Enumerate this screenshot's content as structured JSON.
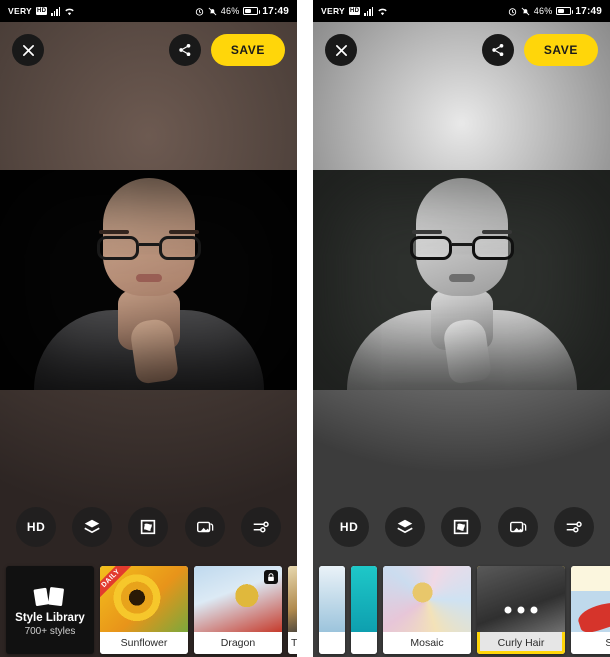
{
  "statusbar": {
    "carrier": "VERY",
    "hd_badge": "HD",
    "battery_percent": "46%",
    "time": "17:49",
    "icons": [
      "signal-bars-icon",
      "wifi-icon",
      "alarm-clock-icon",
      "bell-muted-icon",
      "battery-icon"
    ]
  },
  "topbar": {
    "close_label": "✕",
    "share_label": "share-icon",
    "save_label": "SAVE"
  },
  "tools": [
    {
      "name": "hd-button",
      "label": "HD",
      "icon": "hd-icon"
    },
    {
      "name": "layers-button",
      "label": "",
      "icon": "layers-icon"
    },
    {
      "name": "mask-button",
      "label": "",
      "icon": "mask-frame-icon"
    },
    {
      "name": "gallery-button",
      "label": "",
      "icon": "gallery-icon"
    },
    {
      "name": "adjust-button",
      "label": "",
      "icon": "sliders-icon"
    }
  ],
  "style_library": {
    "title": "Style Library",
    "subtitle": "700+ styles",
    "icon": "photo-stack-icon"
  },
  "left_panel": {
    "background_style": "original-photo",
    "styles": [
      {
        "label": "Sunflower",
        "badge": "DAILY",
        "locked": false,
        "selected": false,
        "art": "art-sun"
      },
      {
        "label": "Dragon",
        "badge": "",
        "locked": true,
        "selected": false,
        "art": "art-dragon"
      },
      {
        "label": "T",
        "badge": "",
        "locked": false,
        "selected": false,
        "art": "art-t",
        "partial": true
      }
    ]
  },
  "right_panel": {
    "background_style": "pencil-sketch-applied",
    "styles": [
      {
        "label": "Mosaic",
        "badge": "",
        "locked": false,
        "selected": false,
        "art": "art-mosaic"
      },
      {
        "label": "Curly Hair",
        "badge": "",
        "locked": false,
        "selected": true,
        "art": "art-curly",
        "loading": true
      },
      {
        "label": "Surf",
        "badge": "",
        "locked": false,
        "selected": false,
        "art": "art-surf"
      }
    ]
  },
  "colors": {
    "accent_yellow": "#FFD60A",
    "ribbon_red": "#E23B2E",
    "button_dark": "#191919"
  }
}
